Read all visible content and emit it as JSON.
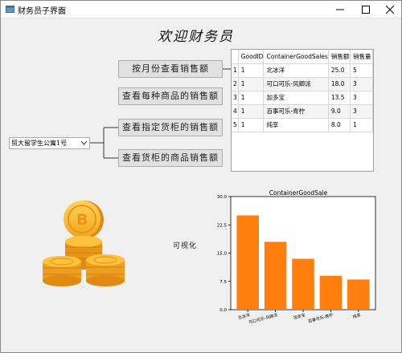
{
  "window": {
    "title": "财务员子界面"
  },
  "header": {
    "welcome": "欢迎财务员"
  },
  "buttons": {
    "monthly_sales": "按月份查看销售额",
    "product_sales": "查看每种商品的销售额",
    "container_sales": "查看指定货柜的销售额",
    "container_product_sales": "查看货柜的商品销售额"
  },
  "container_select": {
    "selected": "贸大留学生公寓1号"
  },
  "table": {
    "columns": [
      "GoodID",
      "ContainerGoodSales",
      "销售额",
      "销售量"
    ],
    "rows": [
      {
        "num": "1",
        "cells": [
          "1",
          "北冰洋",
          "25.0",
          "5"
        ]
      },
      {
        "num": "2",
        "cells": [
          "1",
          "可口可乐-风卿派",
          "18.0",
          "3"
        ]
      },
      {
        "num": "3",
        "cells": [
          "1",
          "加多宝",
          "13.5",
          "3"
        ]
      },
      {
        "num": "4",
        "cells": [
          "1",
          "百事可乐-青柠",
          "9.0",
          "3"
        ]
      },
      {
        "num": "5",
        "cells": [
          "1",
          "纯享",
          "8.0",
          "1"
        ]
      }
    ]
  },
  "visualization_label": "可视化",
  "colors": {
    "bar": "#ff7f0e",
    "coin_gold": "#f6b52a",
    "coin_dark": "#e08a13"
  },
  "chart_data": {
    "type": "bar",
    "title": "ContainerGoodSale",
    "categories": [
      "北冰洋",
      "可口可乐-风卿派",
      "加多宝",
      "百事可乐-青柠",
      "纯享"
    ],
    "values": [
      25.0,
      18.0,
      13.5,
      9.0,
      8.0
    ],
    "ylim": [
      0,
      30
    ],
    "yticks": [
      "0.0",
      "7.5",
      "15.0",
      "22.5",
      "30.0"
    ],
    "xlabel": "",
    "ylabel": "",
    "grid": false
  }
}
